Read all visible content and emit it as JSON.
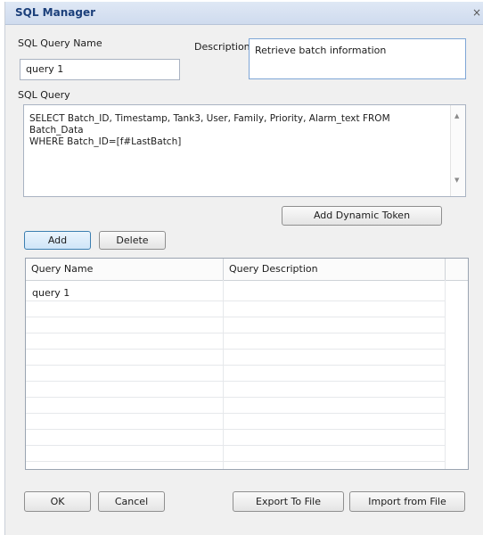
{
  "window": {
    "title": "SQL Manager",
    "close_glyph": "×"
  },
  "form": {
    "query_name_label": "SQL Query Name",
    "query_name_value": "query 1",
    "description_label": "Description",
    "description_value": "Retrieve batch information",
    "sql_query_label": "SQL Query",
    "sql_query_value": "SELECT Batch_ID, Timestamp, Tank3, User, Family, Priority, Alarm_text FROM Batch_Data\nWHERE Batch_ID=[f#LastBatch]",
    "scroll_up_icon": "scroll-up-arrow",
    "scroll_down_icon": "scroll-down-arrow"
  },
  "buttons": {
    "add_dynamic_token": "Add Dynamic Token",
    "add": "Add",
    "delete": "Delete",
    "ok": "OK",
    "cancel": "Cancel",
    "export": "Export To File",
    "import": "Import from File"
  },
  "table": {
    "columns": [
      "Query Name",
      "Query Description"
    ],
    "rows": [
      {
        "name": "query 1",
        "description": ""
      }
    ]
  },
  "colors": {
    "title": "#1b3f7a",
    "active_button_border": "#3c7fb1"
  }
}
